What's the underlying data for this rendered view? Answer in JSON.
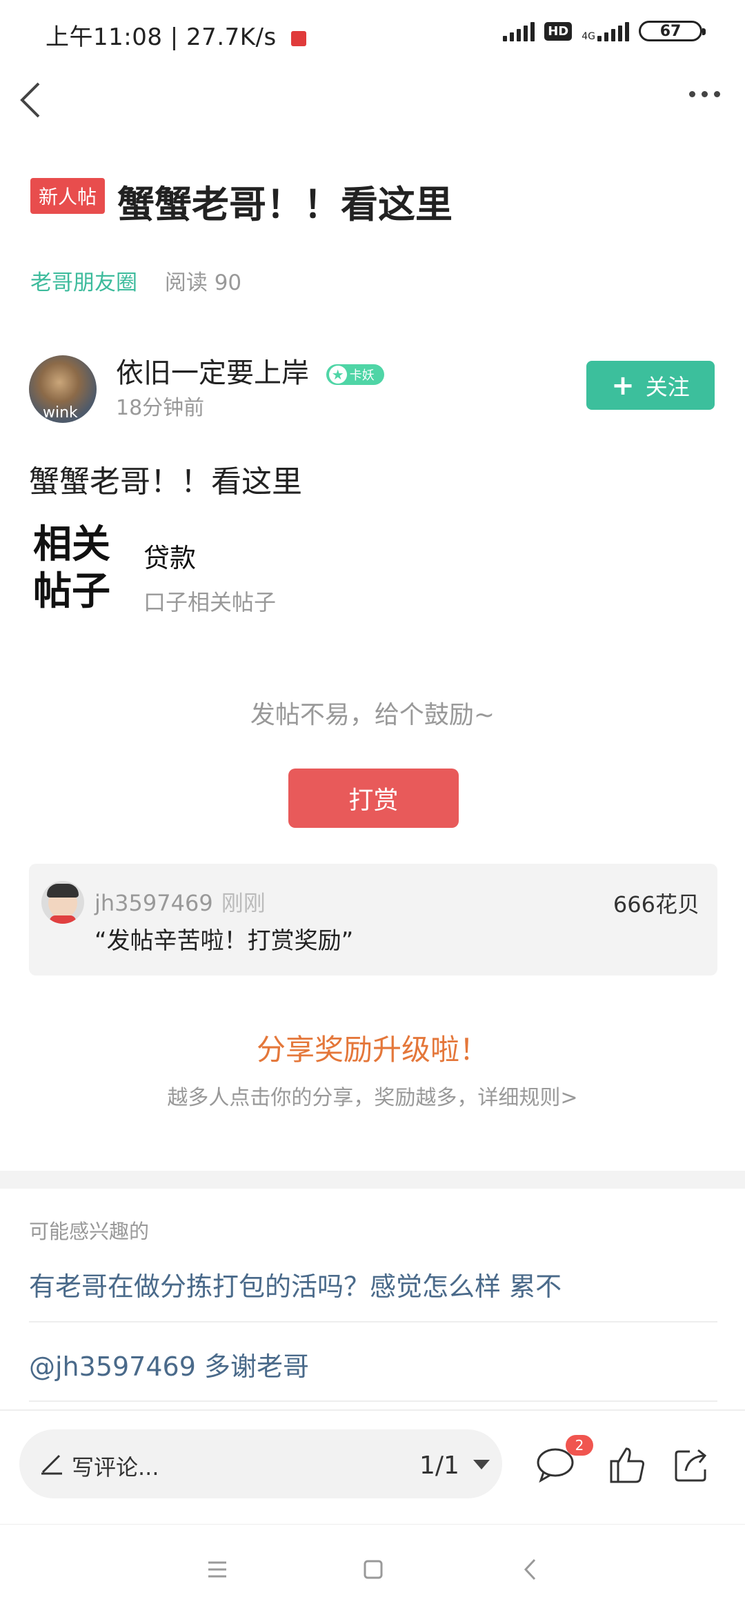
{
  "status_bar": {
    "time_speed": "上午11:08 | 27.7K/s",
    "hd": "HD",
    "network": "4G",
    "battery": "67"
  },
  "post": {
    "badge": "新人帖",
    "title": "蟹蟹老哥！！看这里",
    "circle": "老哥朋友圈",
    "read_count": "阅读 90",
    "author": {
      "name": "依旧一定要上岸",
      "level": "卡妖",
      "time": "18分钟前",
      "avatar_text": "wink"
    },
    "follow_label": "关注",
    "body": "蟹蟹老哥！！看这里",
    "related": {
      "logo_line1": "相关",
      "logo_line2": "帖子",
      "title": "贷款",
      "subtitle": "口子相关帖子"
    }
  },
  "reward": {
    "prompt": "发帖不易，给个鼓励~",
    "button": "打赏",
    "entry": {
      "user": "jh3597469",
      "time": "刚刚",
      "amount": "666花贝",
      "message": "“发帖辛苦啦！打赏奖励”"
    }
  },
  "share": {
    "title": "分享奖励升级啦！",
    "subtitle": "越多人点击你的分享，奖励越多，详细规则>"
  },
  "interest": {
    "label": "可能感兴趣的",
    "items": [
      "有老哥在做分拣打包的活吗？感觉怎么样 累不",
      "@jh3597469 多谢老哥"
    ]
  },
  "bottom": {
    "comment_placeholder": "写评论...",
    "page": "1/1",
    "comment_count": "2"
  },
  "colors": {
    "accent_green": "#3cbf9c",
    "tip_red": "#e85a5a",
    "share_orange": "#e4773a",
    "link_blue": "#4a6a8a"
  }
}
